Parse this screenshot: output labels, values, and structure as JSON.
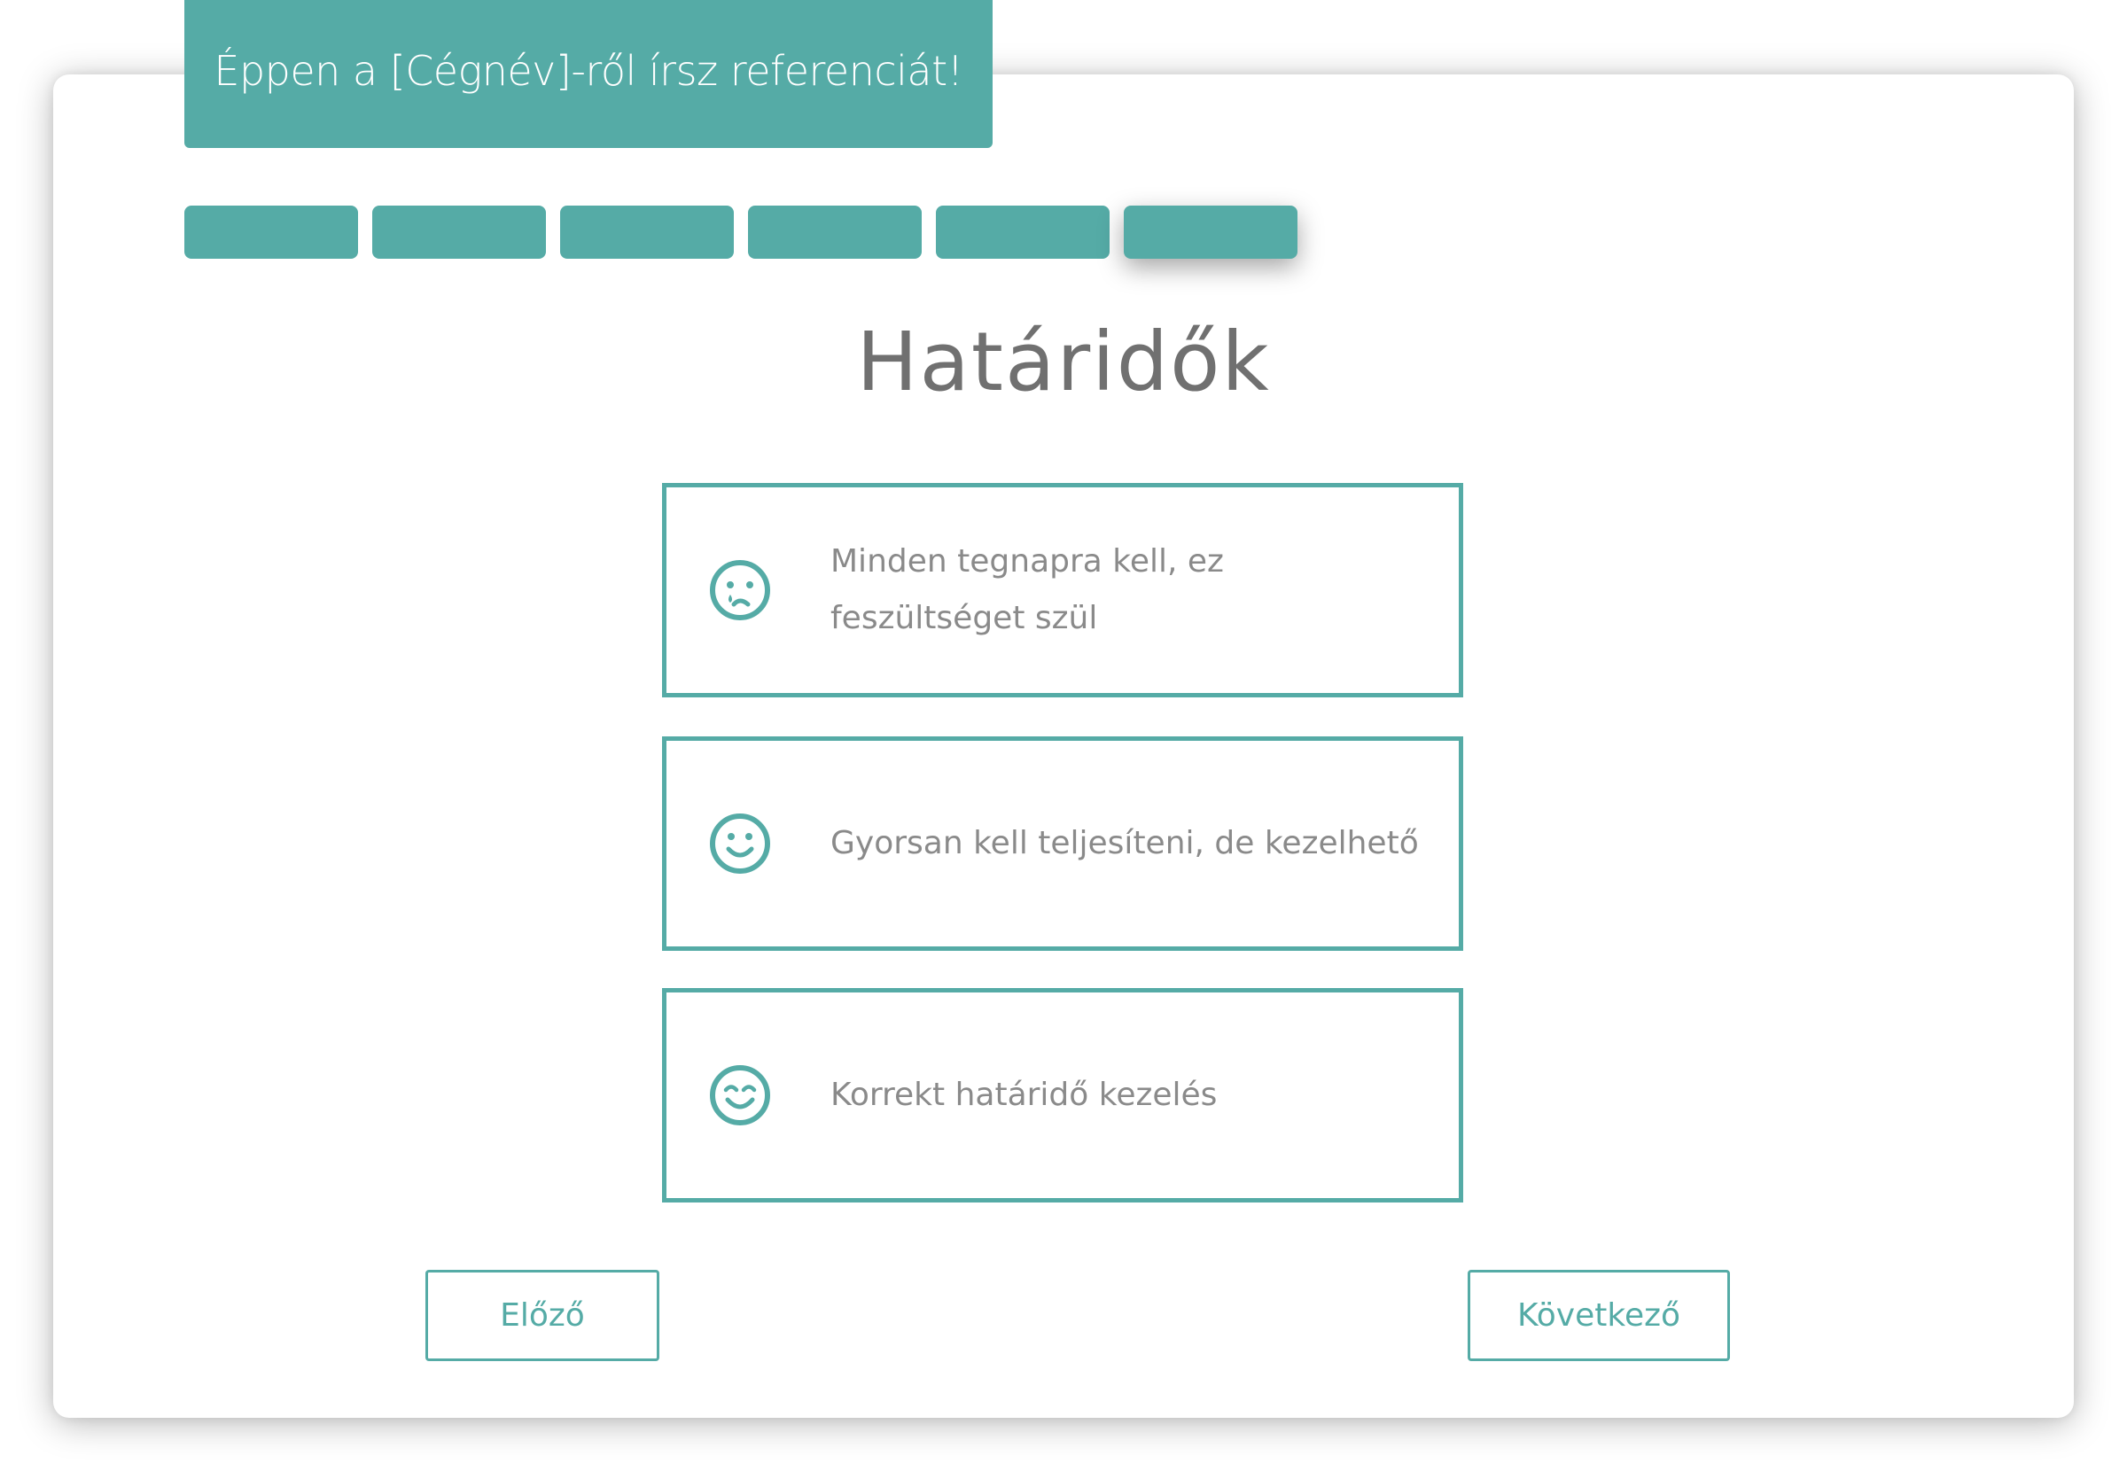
{
  "banner": {
    "text": "Éppen a [Cégnév]-ről írsz referenciát!"
  },
  "steps": {
    "count": 6,
    "active_index": 5
  },
  "page": {
    "title": "Határidők"
  },
  "options": [
    {
      "icon": "sad-crying-face-icon",
      "label": "Minden tegnapra kell, ez feszültséget szül"
    },
    {
      "icon": "smiling-face-icon",
      "label": "Gyorsan kell teljesíteni, de kezelhető"
    },
    {
      "icon": "happy-face-icon",
      "label": "Korrekt határidő kezelés"
    }
  ],
  "nav": {
    "prev_label": "Előző",
    "next_label": "Következő"
  },
  "colors": {
    "accent": "#55aba6",
    "title_text": "#707070",
    "option_text": "#8a8a8a",
    "background": "#ffffff"
  }
}
